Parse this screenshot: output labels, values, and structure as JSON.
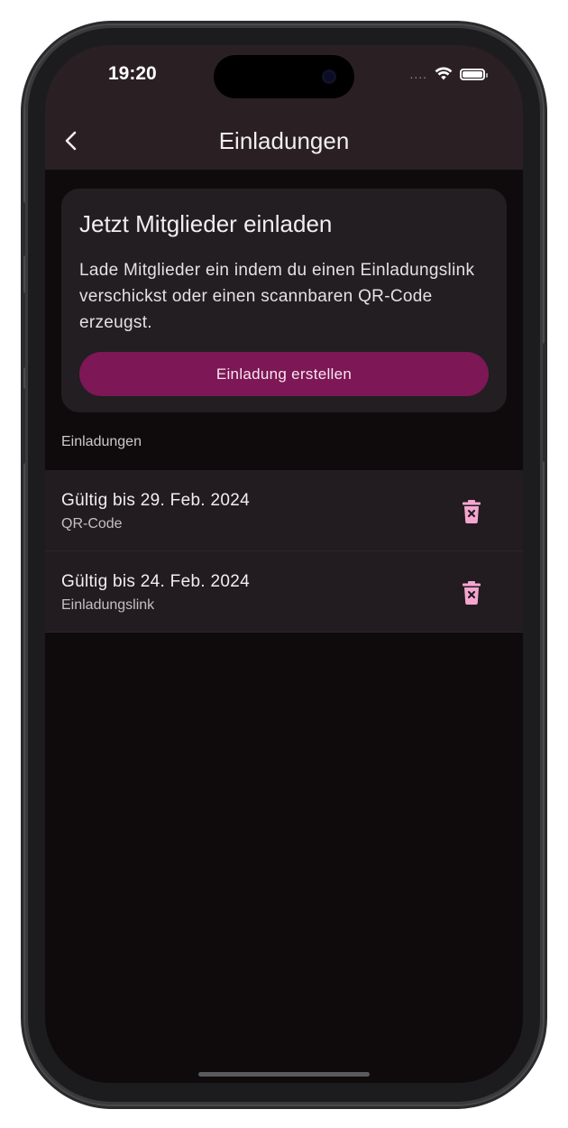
{
  "status_bar": {
    "time": "19:20",
    "signal_dots": "....",
    "wifi_icon": "wifi-icon",
    "battery_icon": "battery-icon"
  },
  "nav": {
    "back_icon": "chevron-left-icon",
    "title": "Einladungen"
  },
  "invite_card": {
    "title": "Jetzt Mitglieder einladen",
    "description": "Lade Mitglieder ein indem du einen Einladungslink verschickst oder einen scannbaren QR-Code erzeugst.",
    "button_label": "Einladung erstellen"
  },
  "section": {
    "label": "Einladungen"
  },
  "invites": [
    {
      "title": "Gültig bis 29. Feb. 2024",
      "type": "QR-Code",
      "delete_icon": "trash-icon"
    },
    {
      "title": "Gültig bis 24. Feb. 2024",
      "type": "Einladungslink",
      "delete_icon": "trash-icon"
    }
  ],
  "colors": {
    "accent": "#7d1756",
    "icon_pink": "#f4a6d0",
    "background": "#0f0b0d",
    "surface": "#231e21"
  }
}
